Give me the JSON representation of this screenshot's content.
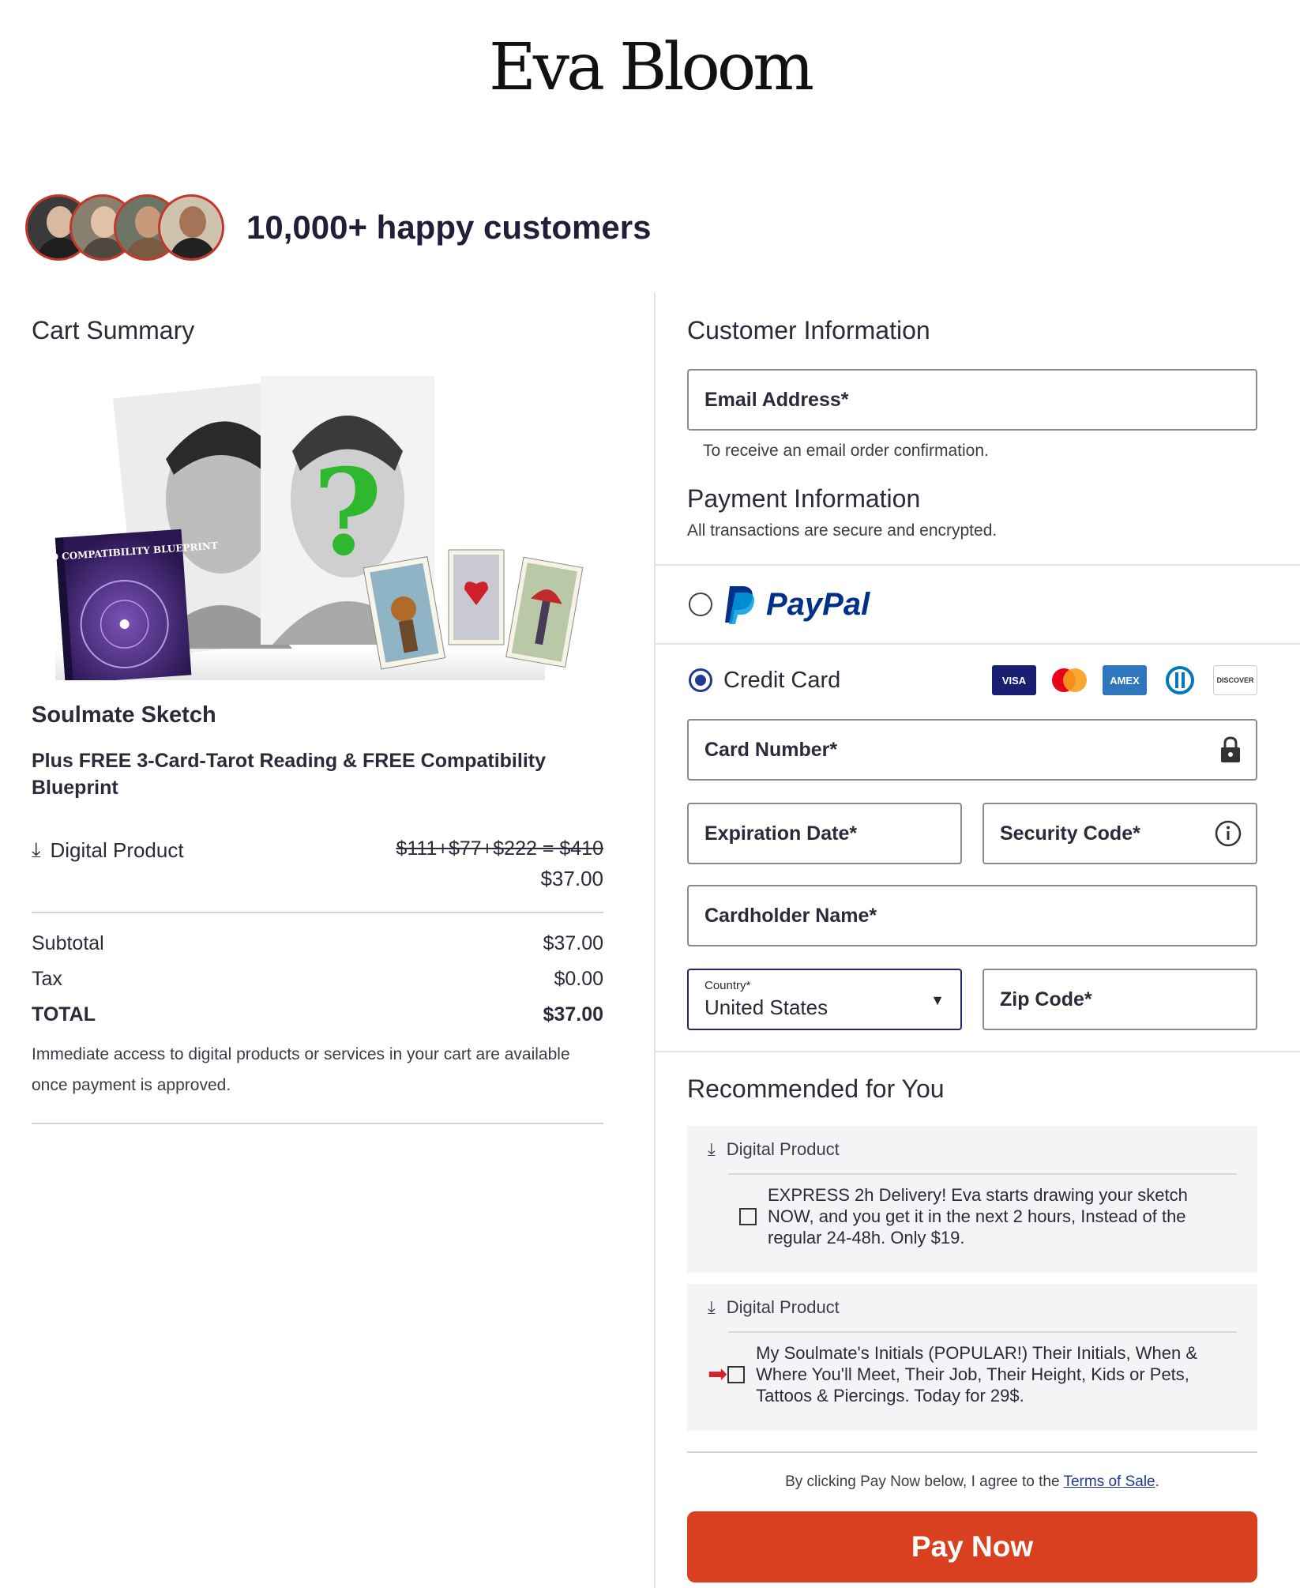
{
  "brand": {
    "logo_text": "Eva Bloom"
  },
  "social_proof": {
    "text": "10,000+ happy customers"
  },
  "cart": {
    "title": "Cart Summary",
    "product_name": "Soulmate Sketch",
    "product_subtitle": "Plus FREE 3-Card-Tarot Reading & FREE Compatibility Blueprint",
    "book_title": "ASTRO COMPATIBILITY BLUEPRINT",
    "line_item": {
      "type_label": "Digital Product",
      "original_price": "$111+$77+$222 = $410",
      "price": "$37.00"
    },
    "subtotal_label": "Subtotal",
    "subtotal_value": "$37.00",
    "tax_label": "Tax",
    "tax_value": "$0.00",
    "total_label": "TOTAL",
    "total_value": "$37.00",
    "note": "Immediate access to digital products or services in your cart are available once payment is approved."
  },
  "customer": {
    "title": "Customer Information",
    "email_placeholder": "Email Address*",
    "email_helper": "To receive an email order confirmation."
  },
  "payment": {
    "title": "Payment Information",
    "subtitle": "All transactions are secure and encrypted.",
    "paypal_label": "PayPal",
    "paypal_selected": false,
    "credit_label": "Credit Card",
    "credit_selected": true,
    "card_brands": [
      "VISA",
      "mastercard",
      "AMEX",
      "diners",
      "DISCOVER"
    ],
    "card_number_label": "Card Number*",
    "expiration_label": "Expiration Date*",
    "security_label": "Security Code*",
    "cardholder_label": "Cardholder Name*",
    "country_label": "Country*",
    "country_value": "United States",
    "zip_label": "Zip Code*"
  },
  "recommended": {
    "title": "Recommended for You",
    "items": [
      {
        "type_label": "Digital Product",
        "text": "EXPRESS 2h Delivery! Eva starts drawing your sketch NOW, and you get it in the next 2 hours, Instead of the regular 24-48h. Only $19.",
        "checked": false
      },
      {
        "type_label": "Digital Product",
        "text": "My Soulmate's Initials (POPULAR!) Their Initials, When & Where You'll Meet, Their Job, Their Height, Kids or Pets, Tattoos & Piercings. Today for 29$.",
        "checked": false
      }
    ]
  },
  "checkout": {
    "agree_prefix": "By clicking Pay Now below, I agree to the ",
    "terms_link": "Terms of Sale",
    "agree_suffix": ".",
    "pay_button": "Pay Now"
  },
  "colors": {
    "accent": "#d8401f",
    "link": "#1f3a8f",
    "paypal_dark": "#003087",
    "paypal_light": "#009cde"
  }
}
